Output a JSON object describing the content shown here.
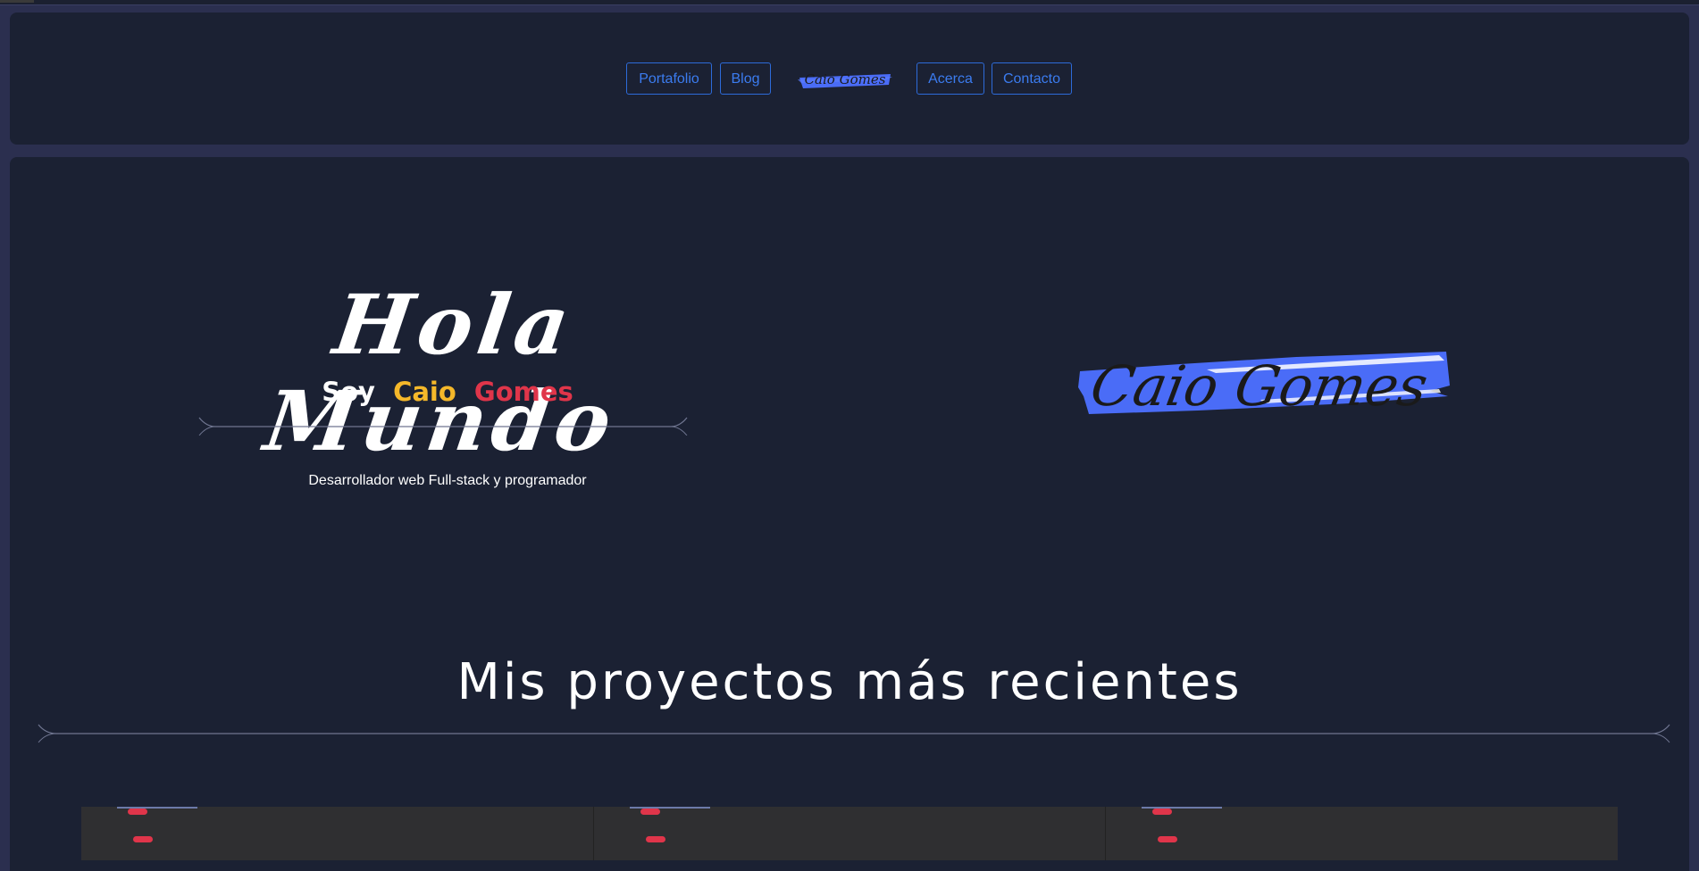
{
  "nav": {
    "items": [
      {
        "label": "Portafolio"
      },
      {
        "label": "Blog"
      },
      {
        "label": "Acerca"
      },
      {
        "label": "Contacto"
      }
    ],
    "logo_text": "Caio Gomes"
  },
  "hero": {
    "title": "Hola Mundo",
    "subtitle": {
      "soy": "Soy",
      "first": "Caio",
      "last": "Gomes"
    },
    "tagline": "Desarrollador web Full-stack y programador",
    "logo_text": "Caio Gomes"
  },
  "projects": {
    "heading": "Mis proyectos más recientes",
    "cards": [
      {},
      {},
      {}
    ]
  },
  "colors": {
    "accent_blue": "#4a6cf7",
    "yellow": "#f5b82a",
    "red": "#e0354a",
    "background": "#1b2133"
  }
}
